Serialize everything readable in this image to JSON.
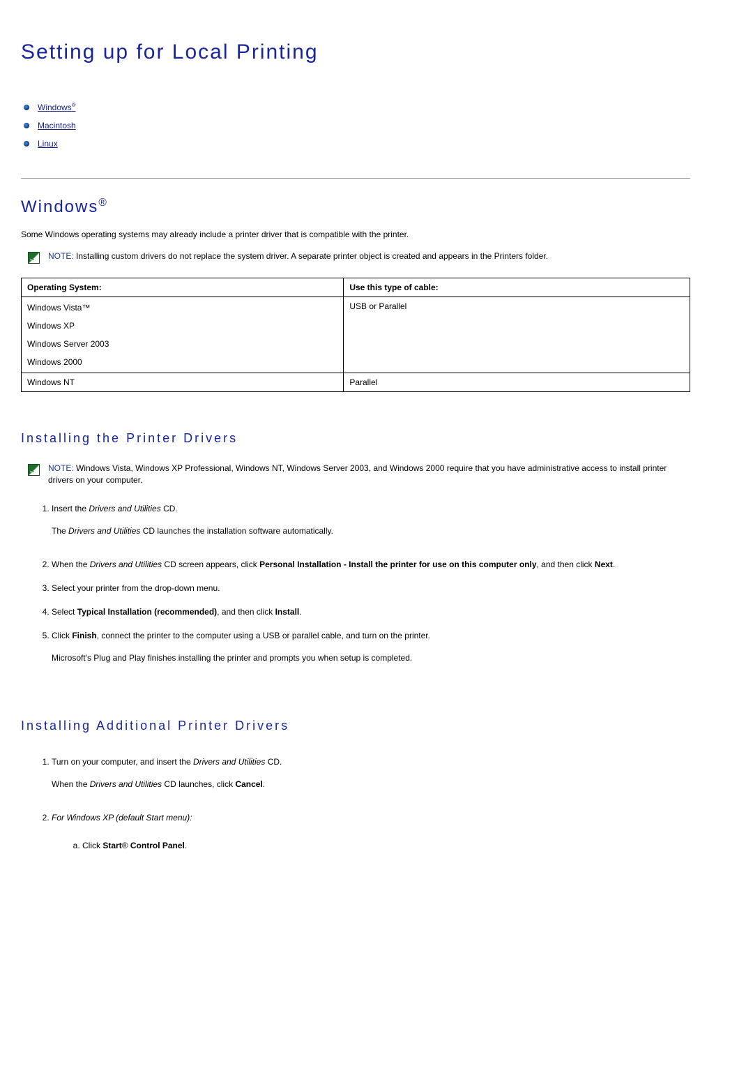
{
  "page_title": "Setting up for Local Printing",
  "nav": [
    {
      "label": "Windows",
      "sup": "®"
    },
    {
      "label": "Macintosh",
      "sup": ""
    },
    {
      "label": "Linux",
      "sup": ""
    }
  ],
  "windows": {
    "heading": "Windows",
    "heading_sup": "®",
    "intro": "Some Windows operating systems may already include a printer driver that is compatible with the printer.",
    "note1_label": "NOTE:",
    "note1_body": " Installing custom drivers do not replace the system driver. A separate printer object is created and appears in the Printers folder.",
    "table": {
      "headers": [
        "Operating System:",
        "Use this type of cable:"
      ],
      "row1_cells": [
        "Windows Vista™",
        "USB or Parallel"
      ],
      "row1_os_more": [
        "Windows XP",
        "Windows Server 2003",
        "Windows 2000"
      ],
      "row2": [
        "Windows NT",
        "Parallel"
      ]
    }
  },
  "install_drivers": {
    "heading": "Installing the Printer Drivers",
    "note_label": "NOTE:",
    "note_body": " Windows Vista, Windows XP Professional, Windows NT, Windows Server 2003, and Windows 2000 require that you have administrative access to install printer drivers on your computer.",
    "step1_a": "Insert the ",
    "step1_it": "Drivers and Utilities",
    "step1_b": " CD.",
    "step1_sub_a": "The ",
    "step1_sub_it": "Drivers and Utilities",
    "step1_sub_b": " CD launches the installation software automatically.",
    "step2_a": "When the ",
    "step2_it": "Drivers and Utilities",
    "step2_b": " CD screen appears, click ",
    "step2_bold1": "Personal Installation - Install the printer for use on this computer only",
    "step2_c": ", and then click ",
    "step2_bold2": "Next",
    "step2_d": ".",
    "step3": "Select your printer from the drop-down menu.",
    "step4_a": "Select ",
    "step4_bold1": "Typical Installation (recommended)",
    "step4_b": ", and then click ",
    "step4_bold2": "Install",
    "step4_c": ".",
    "step5_a": "Click ",
    "step5_bold": "Finish",
    "step5_b": ", connect the printer to the computer using a USB or parallel cable, and turn on the printer.",
    "step5_sub": "Microsoft's Plug and Play finishes installing the printer and prompts you when setup is completed."
  },
  "install_additional": {
    "heading": "Installing Additional Printer Drivers",
    "step1_a": "Turn on your computer, and insert the ",
    "step1_it": "Drivers and Utilities",
    "step1_b": " CD.",
    "step1_sub_a": "When the ",
    "step1_sub_it": "Drivers and Utilities",
    "step1_sub_b": " CD launches, click ",
    "step1_sub_bold": "Cancel",
    "step1_sub_c": ".",
    "step2_it": "For Windows XP (default Start menu):",
    "step2a_a": "Click ",
    "step2a_bold1": "Start",
    "step2a_arrow": "®",
    "step2a_bold2": " Control Panel",
    "step2a_b": "."
  }
}
